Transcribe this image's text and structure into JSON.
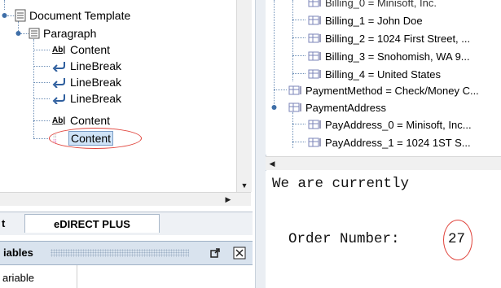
{
  "left_tree": {
    "root_label": "Document Template",
    "paragraph_label": "Paragraph",
    "children": [
      {
        "label": "Content",
        "icon": "text-field-icon"
      },
      {
        "label": "LineBreak",
        "icon": "line-break-icon"
      },
      {
        "label": "LineBreak",
        "icon": "line-break-icon"
      },
      {
        "label": "LineBreak",
        "icon": "line-break-icon"
      },
      {
        "label": "Content",
        "icon": "text-field-icon"
      },
      {
        "label": "Content",
        "icon": "variable-content-icon",
        "selected": true
      }
    ]
  },
  "tabs": {
    "partial_label": "t",
    "active_label": "eDIRECT PLUS"
  },
  "variables_panel": {
    "title_partial": "iables",
    "column_partial": "ariable"
  },
  "right_tree": {
    "top_partial": "Billing_0 = Minisoft, Inc.",
    "items": [
      {
        "label": "Billing_1 = John Doe"
      },
      {
        "label": "Billing_2 = 1024 First Street, ..."
      },
      {
        "label": "Billing_3 = Snohomish, WA 9..."
      },
      {
        "label": "Billing_4 = United States"
      }
    ],
    "payment_method": "PaymentMethod = Check/Money C...",
    "payment_address": "PaymentAddress",
    "pay_items": [
      {
        "label": "PayAddress_0 = Minisoft, Inc..."
      },
      {
        "label": "PayAddress_1 = 1024 1ST S..."
      }
    ]
  },
  "preview": {
    "line1": "We are currently",
    "order_label": "Order Number:",
    "order_number": "27"
  },
  "colors": {
    "highlight_border": "#e0443c",
    "selection_bg": "#cfe3f7",
    "tree_line": "#6d8fb7"
  }
}
